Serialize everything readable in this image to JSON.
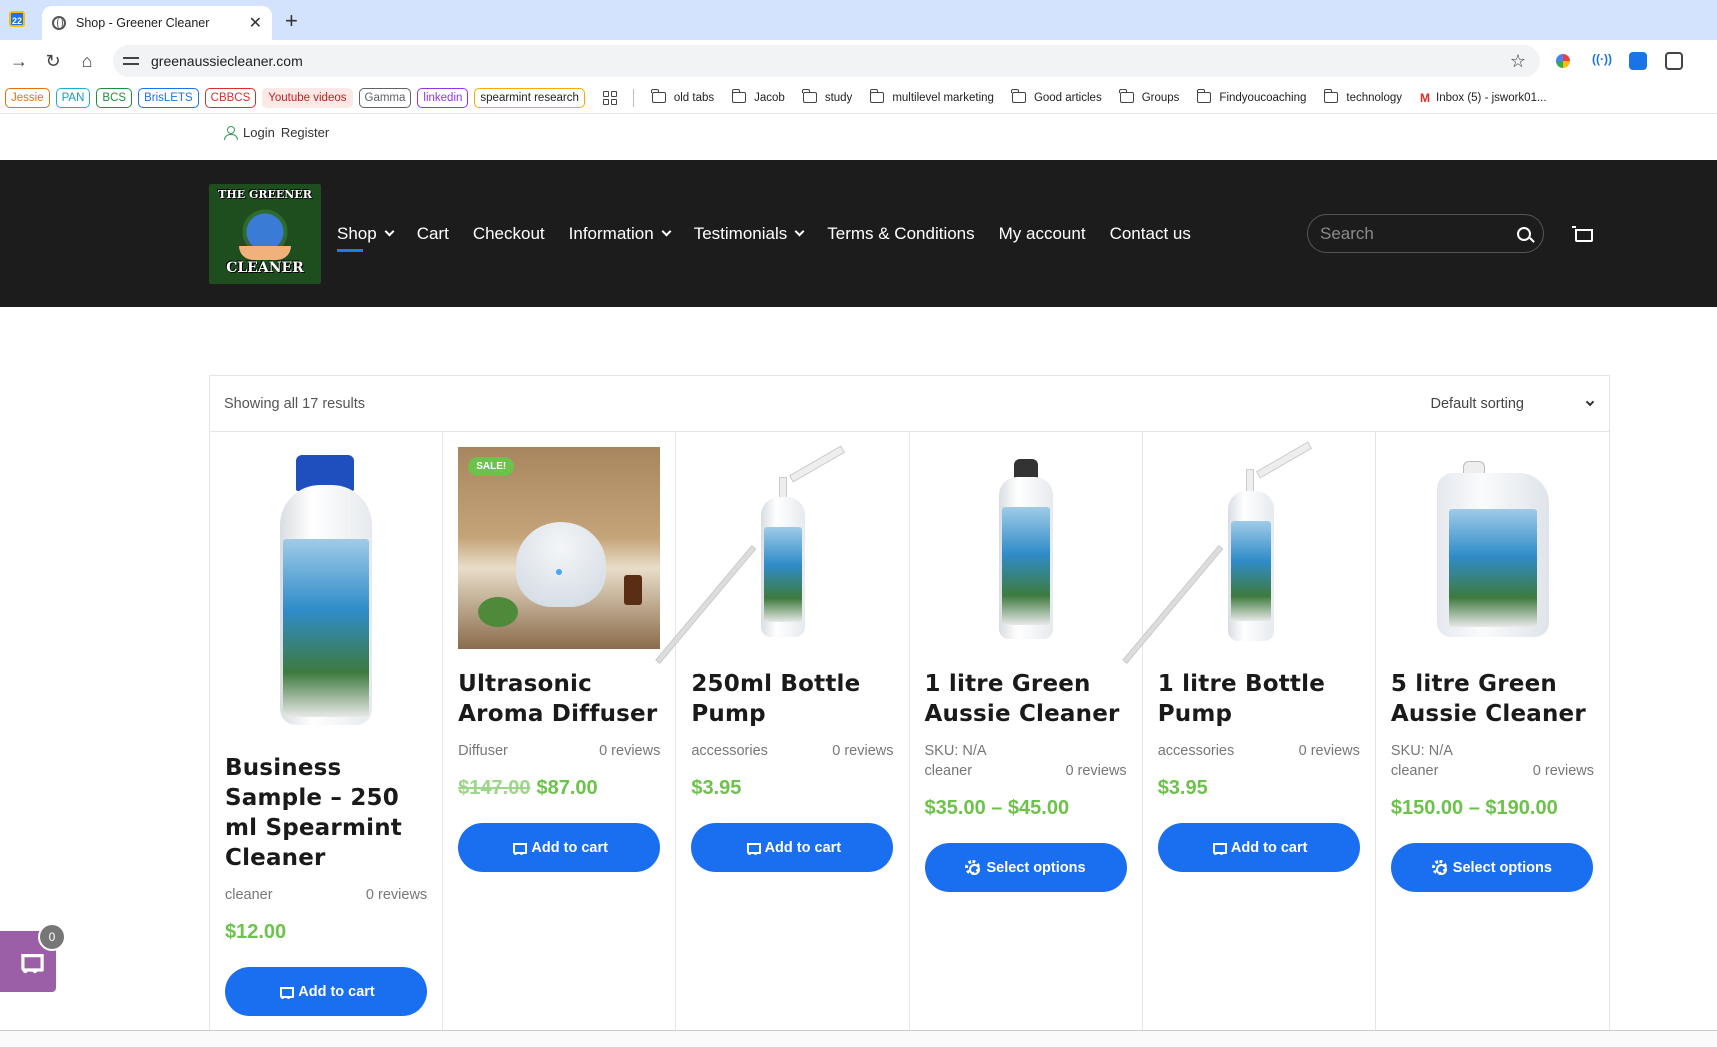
{
  "browser": {
    "tab_title": "Shop - Greener Cleaner",
    "url": "greenaussiecleaner.com",
    "new_tab": "+",
    "close": "✕"
  },
  "bookmarks": {
    "chips": [
      {
        "label": "Jessie",
        "color": "#e8710a"
      },
      {
        "label": "PAN",
        "color": "#12b5cb"
      },
      {
        "label": "BCS",
        "color": "#1e8e3e"
      },
      {
        "label": "BrisLETS",
        "color": "#1a73e8"
      },
      {
        "label": "CBBCS",
        "color": "#d93025"
      },
      {
        "label": "Youtube videos",
        "color": "#f28b82"
      },
      {
        "label": "Gamma",
        "color": "#5f6368"
      },
      {
        "label": "linkedin",
        "color": "#9334e6"
      },
      {
        "label": "spearmint research",
        "color": "#f9ab00"
      }
    ],
    "folders": [
      "old tabs",
      "Jacob",
      "study",
      "multilevel marketing",
      "Good articles",
      "Groups",
      "Findyoucoaching",
      "technology"
    ],
    "gmail": "Inbox (5) - jswork01..."
  },
  "site": {
    "account": {
      "login": "Login",
      "register": "Register"
    },
    "logo": {
      "top": "THE GREENER",
      "bottom": "CLEANER"
    },
    "menu": [
      {
        "label": "Shop",
        "dropdown": true
      },
      {
        "label": "Cart",
        "dropdown": false
      },
      {
        "label": "Checkout",
        "dropdown": false
      },
      {
        "label": "Information",
        "dropdown": true
      },
      {
        "label": "Testimonials",
        "dropdown": true
      },
      {
        "label": "Terms & Conditions",
        "dropdown": false
      },
      {
        "label": "My account",
        "dropdown": false
      },
      {
        "label": "Contact us",
        "dropdown": false
      }
    ],
    "search_placeholder": "Search",
    "shop": {
      "result_count": "Showing all 17 results",
      "sorting": "Default sorting",
      "products": [
        {
          "name": "Business Sample – 250 ml Spearmint Cleaner",
          "category": "cleaner",
          "reviews": "0 reviews",
          "sku": "",
          "price_old": "",
          "price": "$12.00",
          "button": "Add to cart",
          "sale": ""
        },
        {
          "name": "Ultrasonic Aroma Diffuser",
          "category": "Diffuser",
          "reviews": "0 reviews",
          "sku": "",
          "price_old": "$147.00",
          "price": "$87.00",
          "button": "Add to cart",
          "sale": "SALE!"
        },
        {
          "name": "250ml Bottle Pump",
          "category": "accessories",
          "reviews": "0 reviews",
          "sku": "",
          "price_old": "",
          "price": "$3.95",
          "button": "Add to cart",
          "sale": ""
        },
        {
          "name": "1 litre Green Aussie Cleaner",
          "category": "cleaner",
          "reviews": "0 reviews",
          "sku": "SKU: N/A",
          "price_old": "",
          "price": "$35.00 – $45.00",
          "button": "Select options",
          "sale": ""
        },
        {
          "name": "1 litre Bottle Pump",
          "category": "accessories",
          "reviews": "0 reviews",
          "sku": "",
          "price_old": "",
          "price": "$3.95",
          "button": "Add to cart",
          "sale": ""
        },
        {
          "name": "5 litre Green Aussie Cleaner",
          "category": "cleaner",
          "reviews": "0 reviews",
          "sku": "SKU: N/A",
          "price_old": "",
          "price": "$150.00 – $190.00",
          "button": "Select options",
          "sale": ""
        }
      ]
    },
    "mini_cart_count": "0"
  }
}
